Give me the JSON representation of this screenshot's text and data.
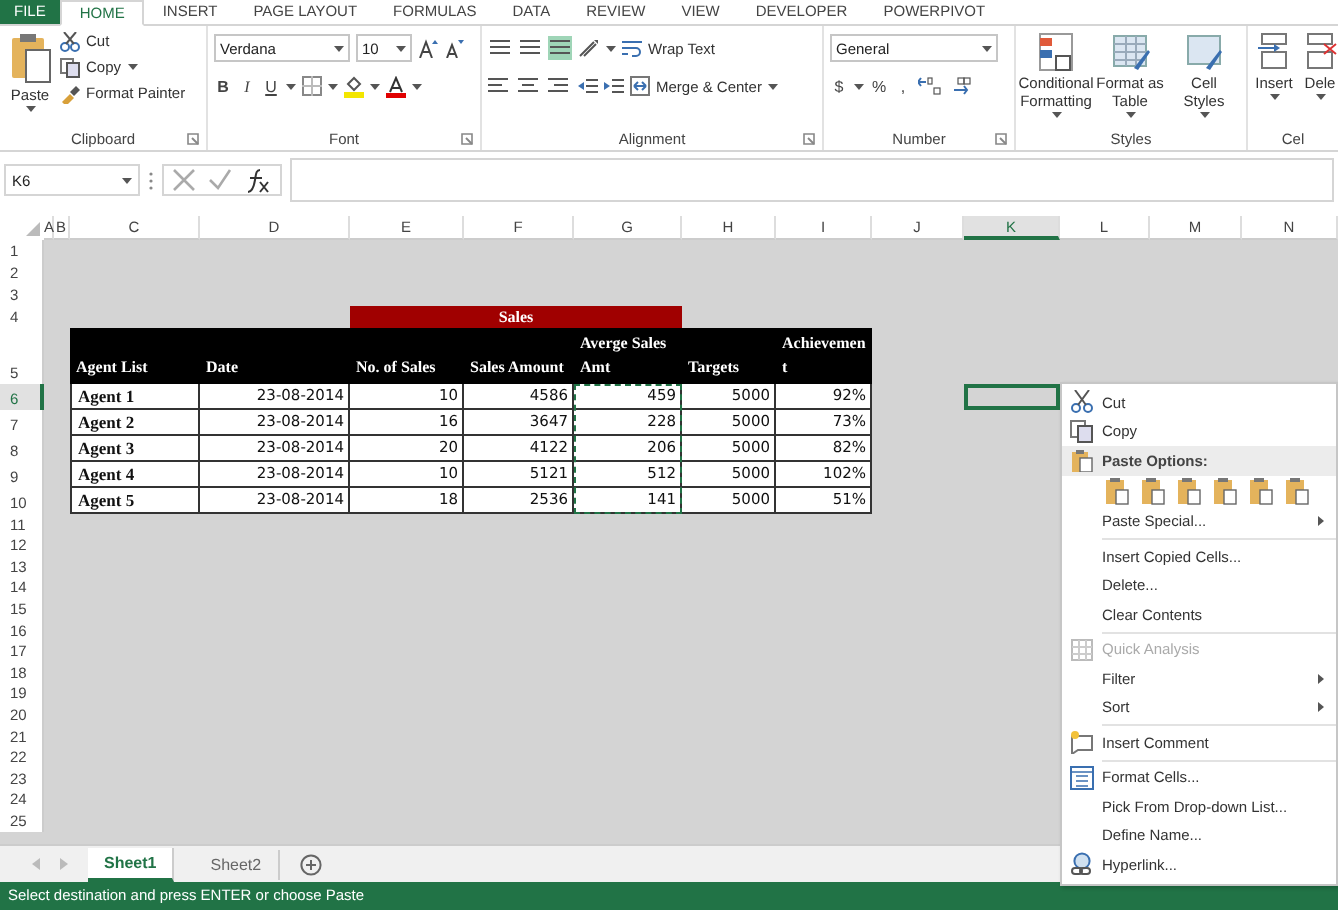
{
  "ribbon": {
    "tabs": [
      {
        "label": "FILE",
        "kind": "file",
        "selected": false
      },
      {
        "label": "HOME",
        "kind": "tab",
        "selected": true
      },
      {
        "label": "INSERT",
        "kind": "tab",
        "selected": false
      },
      {
        "label": "PAGE LAYOUT",
        "kind": "tab",
        "selected": false
      },
      {
        "label": "FORMULAS",
        "kind": "tab",
        "selected": false
      },
      {
        "label": "DATA",
        "kind": "tab",
        "selected": false
      },
      {
        "label": "REVIEW",
        "kind": "tab",
        "selected": false
      },
      {
        "label": "VIEW",
        "kind": "tab",
        "selected": false
      },
      {
        "label": "DEVELOPER",
        "kind": "tab",
        "selected": false
      },
      {
        "label": "POWERPIVOT",
        "kind": "tab",
        "selected": false
      }
    ],
    "groups": [
      {
        "kind": "clipboard",
        "label": "Clipboard",
        "paste": "Paste",
        "cut": "Cut",
        "copy": "Copy",
        "format_painter": "Format Painter"
      },
      {
        "kind": "font",
        "label": "Font",
        "font": "Verdana",
        "size": "10",
        "bold": "B",
        "italic": "I",
        "underline": "U"
      },
      {
        "kind": "alignment",
        "label": "Alignment",
        "wrap": "Wrap Text",
        "merge": "Merge & Center",
        "vertical_align": [
          {
            "selected": false
          },
          {
            "selected": false
          },
          {
            "selected": true
          }
        ]
      },
      {
        "kind": "number",
        "label": "Number",
        "format": "General",
        "currency": "$",
        "percent": "%",
        "comma": ","
      },
      {
        "kind": "styles",
        "label": "Styles",
        "buttons": [
          "Conditional Formatting",
          "Format as Table",
          "Cell Styles"
        ]
      },
      {
        "kind": "cells",
        "label": "Cel",
        "buttons": [
          "Insert",
          "Dele"
        ]
      }
    ]
  },
  "formula_bar": {
    "name_box": "K6"
  },
  "sheet": {
    "column_headers": [
      {
        "label": "A",
        "selected": false
      },
      {
        "label": "B",
        "selected": false
      },
      {
        "label": "C",
        "selected": false
      },
      {
        "label": "D",
        "selected": false
      },
      {
        "label": "E",
        "selected": false
      },
      {
        "label": "F",
        "selected": false
      },
      {
        "label": "G",
        "selected": false
      },
      {
        "label": "H",
        "selected": false
      },
      {
        "label": "I",
        "selected": false
      },
      {
        "label": "J",
        "selected": false
      },
      {
        "label": "K",
        "selected": true
      },
      {
        "label": "L",
        "selected": false
      },
      {
        "label": "M",
        "selected": false
      },
      {
        "label": "N",
        "selected": false
      }
    ],
    "row_headers": [
      {
        "label": "1",
        "selected": false
      },
      {
        "label": "2",
        "selected": false
      },
      {
        "label": "3",
        "selected": false
      },
      {
        "label": "4",
        "selected": false
      },
      {
        "label": "5",
        "selected": false
      },
      {
        "label": "6",
        "selected": true
      },
      {
        "label": "7",
        "selected": false
      },
      {
        "label": "8",
        "selected": false
      },
      {
        "label": "9",
        "selected": false
      },
      {
        "label": "10",
        "selected": false
      },
      {
        "label": "11",
        "selected": false
      },
      {
        "label": "12",
        "selected": false
      },
      {
        "label": "13",
        "selected": false
      },
      {
        "label": "14",
        "selected": false
      },
      {
        "label": "15",
        "selected": false
      },
      {
        "label": "16",
        "selected": false
      },
      {
        "label": "17",
        "selected": false
      },
      {
        "label": "18",
        "selected": false
      },
      {
        "label": "19",
        "selected": false
      },
      {
        "label": "20",
        "selected": false
      },
      {
        "label": "21",
        "selected": false
      },
      {
        "label": "22",
        "selected": false
      },
      {
        "label": "23",
        "selected": false
      },
      {
        "label": "24",
        "selected": false
      },
      {
        "label": "25",
        "selected": false
      }
    ],
    "table": {
      "title": "Sales",
      "columns": [
        {
          "header": "Agent List",
          "copied": false
        },
        {
          "header": "Date",
          "copied": false
        },
        {
          "header": "No. of Sales",
          "copied": false
        },
        {
          "header": "Sales Amount",
          "copied": false
        },
        {
          "header": "Averge Sales Amt",
          "copied": true
        },
        {
          "header": "Targets",
          "copied": false
        },
        {
          "header": "Achievement",
          "copied": false
        }
      ],
      "rows": [
        [
          "Agent 1",
          "23-08-2014",
          "10",
          "4586",
          "459",
          "5000",
          "92%"
        ],
        [
          "Agent 2",
          "23-08-2014",
          "16",
          "3647",
          "228",
          "5000",
          "73%"
        ],
        [
          "Agent 3",
          "23-08-2014",
          "20",
          "4122",
          "206",
          "5000",
          "82%"
        ],
        [
          "Agent 4",
          "23-08-2014",
          "10",
          "5121",
          "512",
          "5000",
          "102%"
        ],
        [
          "Agent 5",
          "23-08-2014",
          "18",
          "2536",
          "141",
          "5000",
          "51%"
        ]
      ]
    }
  },
  "context_menu": [
    {
      "kind": "item",
      "label": "Cut",
      "disabled": false,
      "submenu": false
    },
    {
      "kind": "item",
      "label": "Copy",
      "disabled": false,
      "submenu": false
    },
    {
      "kind": "header",
      "label": "Paste Options:"
    },
    {
      "kind": "paste_icons"
    },
    {
      "kind": "item",
      "label": "Paste Special...",
      "disabled": false,
      "submenu": true
    },
    {
      "kind": "separator"
    },
    {
      "kind": "item",
      "label": "Insert Copied Cells...",
      "disabled": false,
      "submenu": false
    },
    {
      "kind": "item",
      "label": "Delete...",
      "disabled": false,
      "submenu": false
    },
    {
      "kind": "item",
      "label": "Clear Contents",
      "disabled": false,
      "submenu": false
    },
    {
      "kind": "separator"
    },
    {
      "kind": "item",
      "label": "Quick Analysis",
      "disabled": true,
      "submenu": false
    },
    {
      "kind": "item",
      "label": "Filter",
      "disabled": false,
      "submenu": true
    },
    {
      "kind": "item",
      "label": "Sort",
      "disabled": false,
      "submenu": true
    },
    {
      "kind": "separator"
    },
    {
      "kind": "item",
      "label": "Insert Comment",
      "disabled": false,
      "submenu": false
    },
    {
      "kind": "separator"
    },
    {
      "kind": "item",
      "label": "Format Cells...",
      "disabled": false,
      "submenu": false
    },
    {
      "kind": "item",
      "label": "Pick From Drop-down List...",
      "disabled": false,
      "submenu": false
    },
    {
      "kind": "item",
      "label": "Define Name...",
      "disabled": false,
      "submenu": false
    },
    {
      "kind": "item",
      "label": "Hyperlink...",
      "disabled": false,
      "submenu": false
    }
  ],
  "sheet_tabs": [
    {
      "label": "Sheet1",
      "selected": true
    },
    {
      "label": "Sheet2",
      "selected": false
    }
  ],
  "status_bar": "Select destination and press ENTER or choose Paste"
}
